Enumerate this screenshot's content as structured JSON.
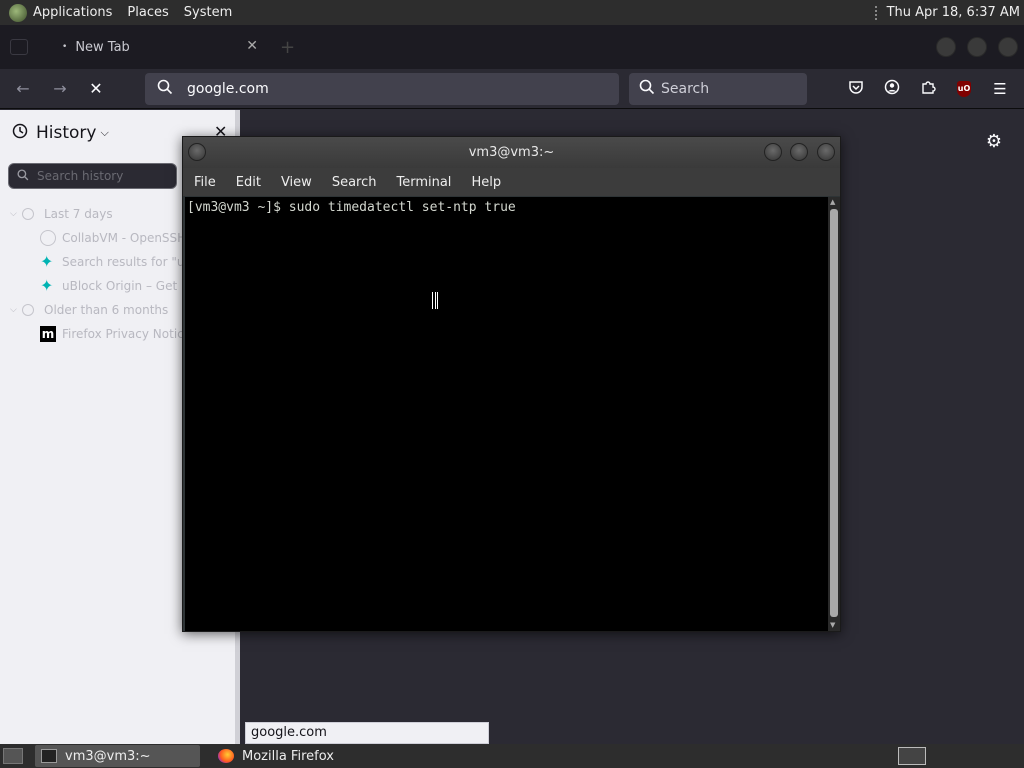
{
  "top_panel": {
    "menus": [
      "Applications",
      "Places",
      "System"
    ],
    "clock": "Thu Apr 18,  6:37 AM"
  },
  "firefox": {
    "tab": {
      "title": "New Tab"
    },
    "urlbar": {
      "value": "google.com"
    },
    "searchbar": {
      "placeholder": "Search"
    },
    "sidebar": {
      "title": "History",
      "search_placeholder": "Search history",
      "groups": [
        {
          "label": "Last 7 days",
          "items": [
            {
              "label": "CollabVM - OpenSSH",
              "icon": "globe-icon"
            },
            {
              "label": "Search results for \"ui",
              "icon": "teal-logo-icon"
            },
            {
              "label": "uBlock Origin – Get",
              "icon": "teal-logo-icon"
            }
          ]
        },
        {
          "label": "Older than 6 months",
          "items": [
            {
              "label": "Firefox Privacy Notice",
              "icon": "mozilla-m-icon"
            }
          ]
        }
      ]
    },
    "status_url": "google.com"
  },
  "terminal": {
    "title": "vm3@vm3:~",
    "menus": [
      "File",
      "Edit",
      "View",
      "Search",
      "Terminal",
      "Help"
    ],
    "lines": [
      "[vm3@vm3 ~]$ sudo timedatectl set-ntp true"
    ]
  },
  "taskbar": {
    "tasks": [
      {
        "label": "vm3@vm3:~",
        "active": true,
        "icon": "terminal-icon"
      },
      {
        "label": "Mozilla Firefox",
        "active": false,
        "icon": "firefox-icon"
      }
    ]
  }
}
